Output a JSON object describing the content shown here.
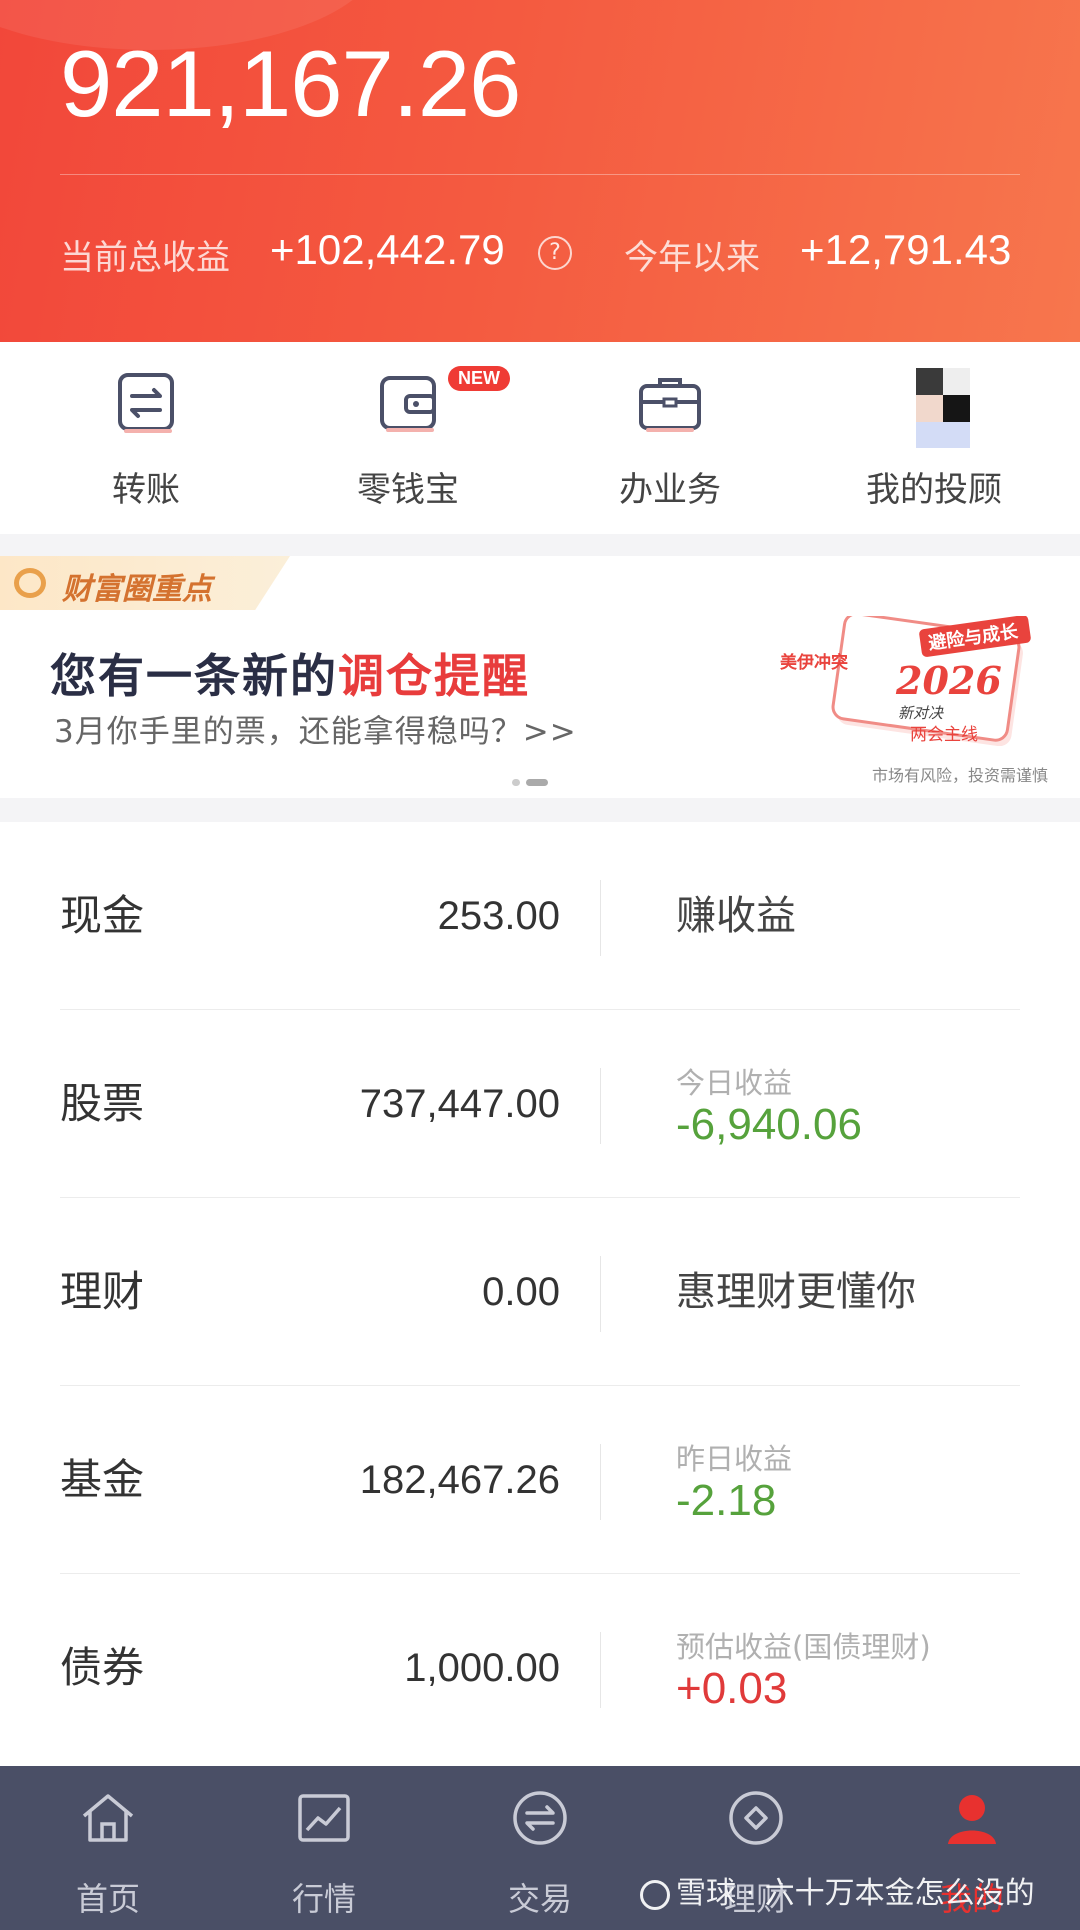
{
  "header": {
    "total_assets": "921,167.26",
    "total_profit_label": "当前总收益",
    "total_profit_value": "+102,442.79",
    "ytd_label": "今年以来",
    "ytd_value": "+12,791.43"
  },
  "quick_actions": [
    {
      "label": "转账",
      "icon": "transfer-icon"
    },
    {
      "label": "零钱宝",
      "icon": "wallet-icon",
      "badge": "NEW"
    },
    {
      "label": "办业务",
      "icon": "briefcase-icon"
    },
    {
      "label": "我的投顾",
      "icon": "advisor-avatar"
    }
  ],
  "banner": {
    "tag": "财富圈重点",
    "title_prefix": "您有一条新的",
    "title_highlight": "调仓提醒",
    "subtitle": "3月你手里的票，还能拿得稳吗？>>",
    "art_line1": "避险与成长",
    "art_line2": "美伊冲突",
    "art_year": "2026",
    "art_line3": "新对决",
    "art_line4": "两会主线",
    "risk_note": "市场有风险，投资需谨慎"
  },
  "assets": [
    {
      "name": "现金",
      "amount": "253.00",
      "right_text": "赚收益"
    },
    {
      "name": "股票",
      "amount": "737,447.00",
      "right_label": "今日收益",
      "right_value": "-6,940.06"
    },
    {
      "name": "理财",
      "amount": "0.00",
      "right_text": "惠理财更懂你"
    },
    {
      "name": "基金",
      "amount": "182,467.26",
      "right_label": "昨日收益",
      "right_value": "-2.18"
    },
    {
      "name": "债券",
      "amount": "1,000.00",
      "right_label": "预估收益(国债理财)",
      "right_value": "+0.03"
    }
  ],
  "nav": [
    {
      "label": "首页",
      "icon": "home-icon"
    },
    {
      "label": "行情",
      "icon": "chart-icon"
    },
    {
      "label": "交易",
      "icon": "exchange-icon"
    },
    {
      "label": "理财",
      "icon": "diamond-icon"
    },
    {
      "label": "我的",
      "icon": "user-icon",
      "active": true
    }
  ],
  "watermark": "雪球 · 六十万本金怎么没的",
  "colors": {
    "header": "#f2473a",
    "loss": "#56a23c",
    "gain": "#e03a3a",
    "nav_bg": "#4a4f66",
    "active": "#e8312f"
  }
}
